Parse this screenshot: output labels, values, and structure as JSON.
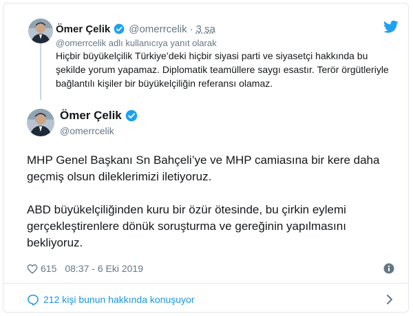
{
  "parent_tweet": {
    "author_name": "Ömer Çelik",
    "handle": "@omerrcelik",
    "separator": "·",
    "time": "3 sa",
    "reply_context": "@omerrcelik adlı kullanıcıya yanıt olarak",
    "text": "Hiçbir büyükelçilik Türkiye’deki hiçbir siyasi parti ve siyasetçi hakkında bu şekilde yorum yapamaz. Diplomatik teamüllere saygı esastır. Terör örgütleriyle bağlantılı kişiler bir büyükelçiliğin referansı olamaz."
  },
  "main_tweet": {
    "author_name": "Ömer Çelik",
    "handle": "@omerrcelik",
    "paragraphs": [
      "MHP Genel Başkanı Sn Bahçeli’ye ve MHP camiasına bir kere daha geçmiş olsun dileklerimizi iletiyoruz.",
      "ABD büyükelçiliğinden kuru bir özür ötesinde, bu çirkin eylemi gerçekleştirenlere dönük soruşturma ve gereğinin yapılmasını bekliyoruz."
    ],
    "likes": "615",
    "timestamp": "08:37 - 6 Eki 2019"
  },
  "footer": {
    "conversation_label": "212 kişi bunun hakkında konuşuyor"
  },
  "colors": {
    "accent": "#1da1f2",
    "link": "#1b95e0",
    "muted": "#657786",
    "text": "#14171a",
    "border": "#e1e8ed"
  },
  "icons": {
    "verified": "verified-badge-icon",
    "twitter": "twitter-bird-icon",
    "like": "heart-icon",
    "info": "info-icon",
    "reply": "speech-bubble-icon",
    "chevron": "chevron-right-icon"
  }
}
